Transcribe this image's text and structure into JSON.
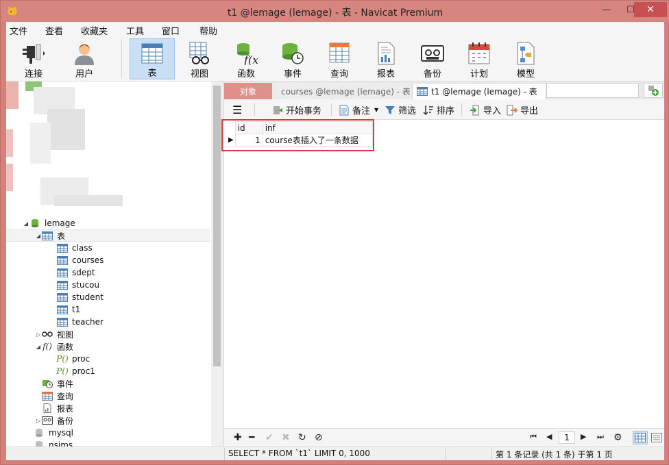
{
  "window": {
    "title": "t1 @lemage (lemage) - 表 - Navicat Premium",
    "minimize": "—",
    "maximize": "☐",
    "close": "✕"
  },
  "menu": [
    "文件",
    "查看",
    "收藏夹",
    "工具",
    "窗口",
    "帮助"
  ],
  "toolbar": [
    {
      "label": "连接",
      "icon": "plug-icon"
    },
    {
      "label": "用户",
      "icon": "user-icon"
    },
    {
      "label": "表",
      "icon": "table-icon",
      "active": true
    },
    {
      "label": "视图",
      "icon": "view-icon"
    },
    {
      "label": "函数",
      "icon": "function-icon"
    },
    {
      "label": "事件",
      "icon": "event-icon"
    },
    {
      "label": "查询",
      "icon": "query-icon"
    },
    {
      "label": "报表",
      "icon": "report-icon"
    },
    {
      "label": "备份",
      "icon": "backup-icon"
    },
    {
      "label": "计划",
      "icon": "calendar-icon"
    },
    {
      "label": "模型",
      "icon": "model-icon"
    }
  ],
  "tree": {
    "database": "lemage",
    "tables_label": "表",
    "tables": [
      "class",
      "courses",
      "sdept",
      "stucou",
      "student",
      "t1",
      "teacher"
    ],
    "views_label": "视图",
    "functions_label": "函数",
    "functions": [
      "proc",
      "proc1"
    ],
    "events_label": "事件",
    "queries_label": "查询",
    "reports_label": "报表",
    "backups_label": "备份",
    "other_dbs": [
      "mysql",
      "nsims"
    ]
  },
  "tabs": {
    "objects": "对象",
    "courses": "courses @lemage (lemage) - 表",
    "t1": "t1 @lemage (lemage) - 表"
  },
  "subtoolbar": {
    "begin_transaction": "开始事务",
    "memo": "备注",
    "filter": "筛选",
    "sort": "排序",
    "import": "导入",
    "export": "导出"
  },
  "grid": {
    "columns": [
      "id",
      "inf"
    ],
    "rows": [
      [
        "1",
        "course表插入了一条数据"
      ]
    ]
  },
  "pager": {
    "current_page": "1"
  },
  "status": {
    "sql": "SELECT * FROM `t1` LIMIT 0, 1000",
    "record_info": "第 1 条记录 (共 1 条) 于第 1 页"
  },
  "colors": {
    "accent": "#c9dff5",
    "titlebar": "#d6867f",
    "highlight": "#e03b3b"
  }
}
